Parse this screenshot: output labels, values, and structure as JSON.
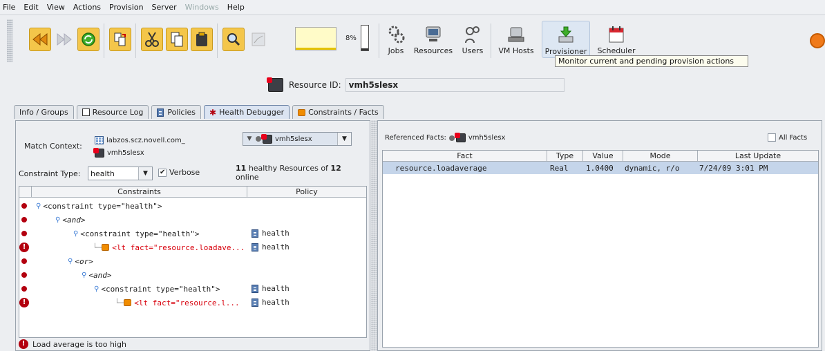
{
  "menu": [
    "File",
    "Edit",
    "View",
    "Actions",
    "Provision",
    "Server",
    "Windows",
    "Help"
  ],
  "toolbar": {
    "progress_label": "8%",
    "buttons": [
      "Jobs",
      "Resources",
      "Users",
      "VM Hosts",
      "Provisioner",
      "Scheduler"
    ],
    "tooltip": "Monitor current and pending provision actions"
  },
  "resource": {
    "label": "Resource ID:",
    "value": "vmh5slesx"
  },
  "tabs": [
    "Info / Groups",
    "Resource Log",
    "Policies",
    "Health Debugger",
    "Constraints / Facts"
  ],
  "debugger": {
    "match_context_label": "Match Context:",
    "context_items": [
      "labzos.scz.novell.com_",
      "vmh5slesx"
    ],
    "context_combo": "vmh5slesx",
    "constraint_type_label": "Constraint Type:",
    "constraint_type": "health",
    "verbose_label": "Verbose",
    "healthy_count": "11",
    "healthy_text_1": "healthy Resources of",
    "total_count": "12",
    "healthy_text_2": "online",
    "columns": [
      "Constraints",
      "Policy"
    ],
    "rows": [
      {
        "text": "<constraint type=\"health\">",
        "policy": "",
        "status": "bullet",
        "italic": false,
        "red": false
      },
      {
        "text": "<and>",
        "policy": "",
        "status": "bullet",
        "italic": true,
        "red": false
      },
      {
        "text": "<constraint type=\"health\">",
        "policy": "health",
        "status": "bullet",
        "italic": false,
        "red": false
      },
      {
        "text": "<lt fact=\"resource.loadave...",
        "policy": "health",
        "status": "warn",
        "italic": false,
        "red": true
      },
      {
        "text": "<or>",
        "policy": "",
        "status": "bullet",
        "italic": true,
        "red": false
      },
      {
        "text": "<and>",
        "policy": "",
        "status": "bullet",
        "italic": true,
        "red": false
      },
      {
        "text": "<constraint type=\"health\">",
        "policy": "health",
        "status": "bullet",
        "italic": false,
        "red": false
      },
      {
        "text": "<lt fact=\"resource.l...",
        "policy": "health",
        "status": "warn",
        "italic": false,
        "red": true
      }
    ],
    "status_message": "Load average is too high"
  },
  "facts": {
    "referenced_label": "Referenced Facts:",
    "referenced_value": "vmh5slesx",
    "all_facts_label": "All Facts",
    "columns": [
      "Fact",
      "Type",
      "Value",
      "Mode",
      "Last Update"
    ],
    "rows": [
      {
        "fact": "resource.loadaverage",
        "type": "Real",
        "value": "1.0400",
        "mode": "dynamic, r/o",
        "last_update": "7/24/09 3:01 PM"
      }
    ]
  }
}
